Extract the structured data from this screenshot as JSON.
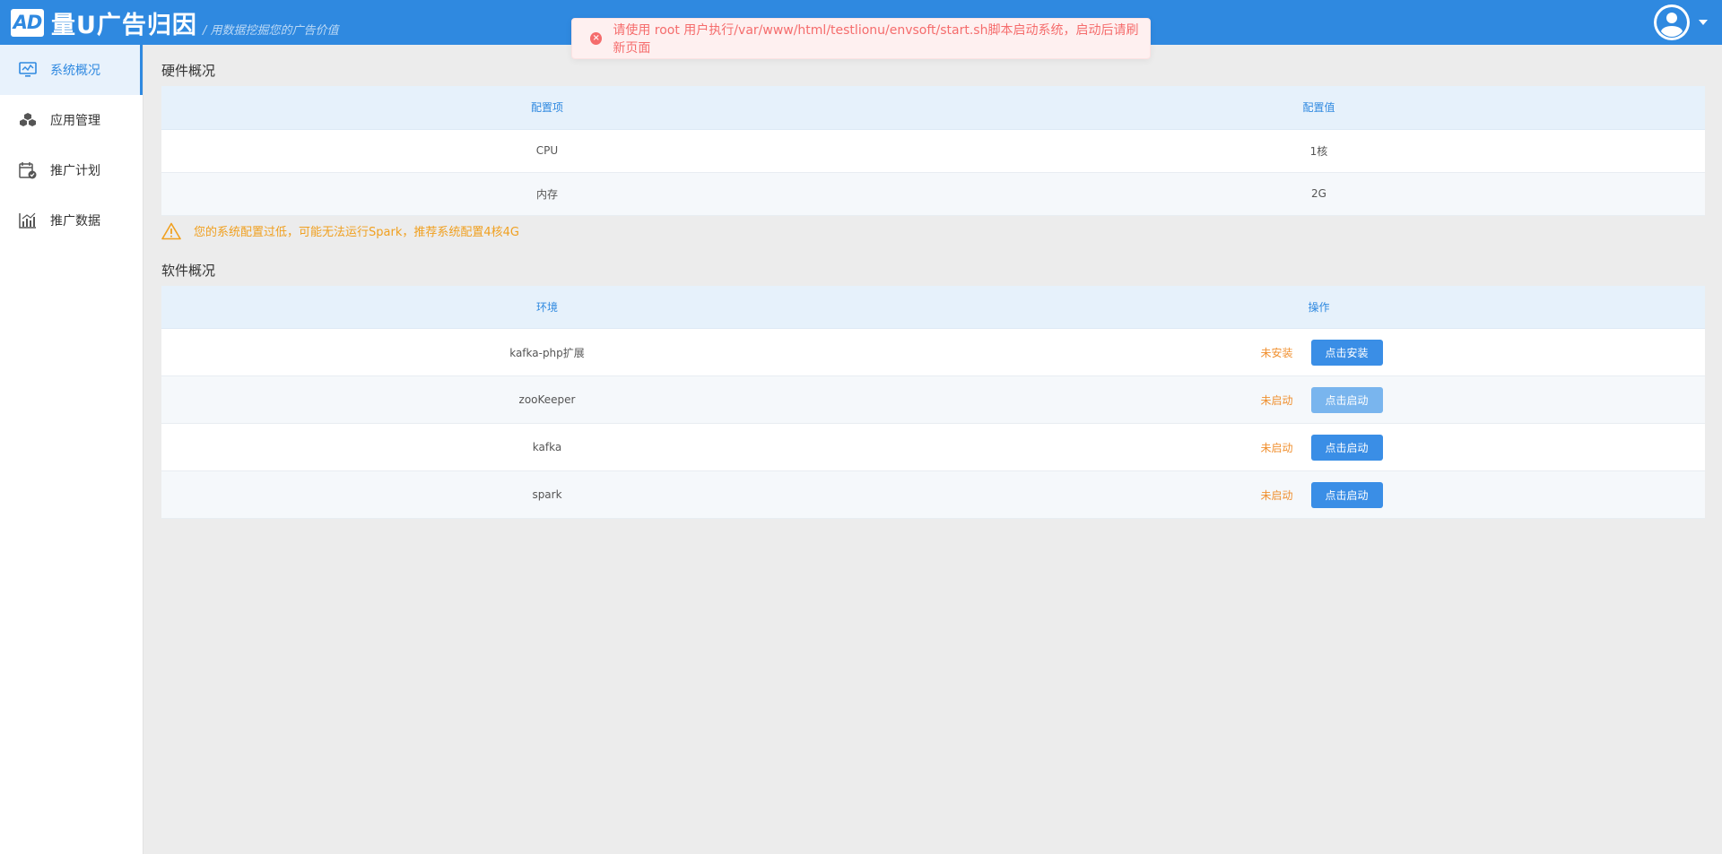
{
  "header": {
    "logo_mark": "AD",
    "logo_name": "量U广告归因",
    "slogan": "/ 用数据挖掘您的广告价值",
    "avatar_icon": "user-avatar-icon",
    "menu_icon": "caret-down-icon"
  },
  "toast": {
    "type": "error",
    "icon": "error-circle-icon",
    "message": "请使用 root 用户执行/var/www/html/testlionu/envsoft/start.sh脚本启动系统，启动后请刷新页面"
  },
  "sidebar": {
    "items": [
      {
        "label": "系统概况",
        "icon": "monitor-icon",
        "active": true
      },
      {
        "label": "应用管理",
        "icon": "cubes-icon",
        "active": false
      },
      {
        "label": "推广计划",
        "icon": "calendar-check-icon",
        "active": false
      },
      {
        "label": "推广数据",
        "icon": "bar-chart-icon",
        "active": false
      }
    ]
  },
  "hardware": {
    "title": "硬件概况",
    "columns": [
      "配置项",
      "配置值"
    ],
    "rows": [
      {
        "item": "CPU",
        "value": "1核"
      },
      {
        "item": "内存",
        "value": "2G"
      }
    ],
    "warning": "您的系统配置过低，可能无法运行Spark，推荐系统配置4核4G"
  },
  "software": {
    "title": "软件概况",
    "columns": [
      "环境",
      "操作"
    ],
    "rows": [
      {
        "env": "kafka-php扩展",
        "status": "未安装",
        "action": "点击安装",
        "disabled": false
      },
      {
        "env": "zooKeeper",
        "status": "未启动",
        "action": "点击启动",
        "disabled": true
      },
      {
        "env": "kafka",
        "status": "未启动",
        "action": "点击启动",
        "disabled": false
      },
      {
        "env": "spark",
        "status": "未启动",
        "action": "点击启动",
        "disabled": false
      }
    ]
  },
  "colors": {
    "primary": "#2f89e0",
    "warning": "#f0a020",
    "error": "#f56c6c"
  }
}
